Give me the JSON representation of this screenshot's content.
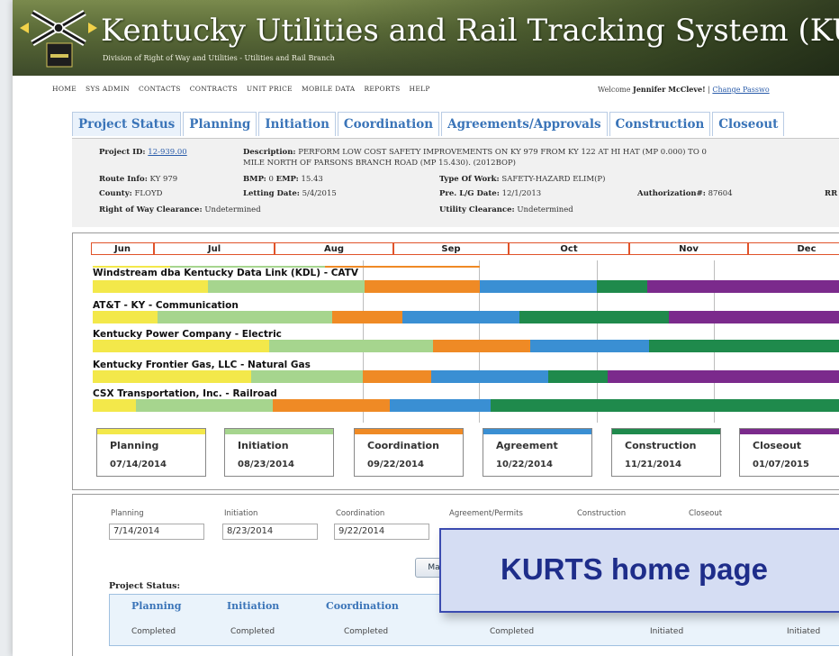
{
  "header": {
    "title": "Kentucky Utilities and Rail Tracking System (KURTS",
    "subtitle": "Division of Right of Way and Utilities - Utilities and Rail Branch"
  },
  "nav": {
    "items": [
      "Home",
      "Sys Admin",
      "Contacts",
      "Contracts",
      "Unit Price",
      "Mobile Data",
      "Reports",
      "Help"
    ]
  },
  "user": {
    "welcome_prefix": "Welcome",
    "name": "Jennifer McCleve!",
    "separator": "|",
    "change_password": "Change Passwo"
  },
  "tabs": [
    "Project Status",
    "Planning",
    "Initiation",
    "Coordination",
    "Agreements/Approvals",
    "Construction",
    "Closeout"
  ],
  "project": {
    "id_label": "Project ID:",
    "id_value": "12-939.00",
    "desc_label": "Description:",
    "desc_line1": "PERFORM LOW COST SAFETY IMPROVEMENTS ON KY 979 FROM KY 122 AT HI HAT (MP 0.000) TO 0",
    "desc_line2": "MILE NORTH OF PARSONS BRANCH ROAD (MP 15.430). (2012BOP)",
    "route_label": "Route Info:",
    "route_value": "KY 979",
    "bmp_label": "BMP:",
    "bmp_value": "0",
    "emp_label": "EMP:",
    "emp_value": "15.43",
    "work_label": "Type Of Work:",
    "work_value": "SAFETY-HAZARD ELIM(P)",
    "county_label": "County:",
    "county_value": "FLOYD",
    "letting_label": "Letting Date:",
    "letting_value": "5/4/2015",
    "prelg_label": "Pre. L/G Date:",
    "prelg_value": "12/1/2013",
    "auth_label": "Authorization#:",
    "auth_value": "87604",
    "rr_label": "RR",
    "row_label": "Right of Way Clearance:",
    "row_value": "Undetermined",
    "util_label": "Utility Clearance:",
    "util_value": "Undetermined"
  },
  "gantt": {
    "months": [
      "Jun",
      "Jul",
      "Aug",
      "Sep",
      "Oct",
      "Nov",
      "Dec"
    ],
    "colors": {
      "planning": "#f3e84a",
      "initiation": "#a6d58e",
      "coordination": "#ef8a25",
      "agreement": "#3a8fd3",
      "construction": "#1f8a4c",
      "closeout": "#7b2a8c"
    },
    "utilities": [
      {
        "name": "Windstream dba Kentucky Data Link (KDL) - CATV"
      },
      {
        "name": "AT&T - KY - Communication"
      },
      {
        "name": "Kentucky Power Company - Electric"
      },
      {
        "name": "Kentucky Frontier Gas, LLC - Natural Gas"
      },
      {
        "name": "CSX Transportation, Inc. - Railroad"
      }
    ],
    "phases": [
      {
        "label": "Planning",
        "date": "07/14/2014",
        "color": "#f3e84a"
      },
      {
        "label": "Initiation",
        "date": "08/23/2014",
        "color": "#a6d58e"
      },
      {
        "label": "Coordination",
        "date": "09/22/2014",
        "color": "#ef8a25"
      },
      {
        "label": "Agreement",
        "date": "10/22/2014",
        "color": "#3a8fd3"
      },
      {
        "label": "Construction",
        "date": "11/21/2014",
        "color": "#1f8a4c"
      },
      {
        "label": "Closeout",
        "date": "01/07/2015",
        "color": "#7b2a8c"
      }
    ]
  },
  "dates": {
    "labels": [
      "Planning",
      "Initiation",
      "Coordination",
      "Agreement/Permits",
      "Construction",
      "Closeout"
    ],
    "values": [
      "7/14/2014",
      "8/23/2014",
      "9/22/2014"
    ],
    "button_label": "Ma"
  },
  "status": {
    "title": "Project Status:",
    "headers": [
      "Planning",
      "Initiation",
      "Coordination"
    ],
    "values": [
      "Completed",
      "Completed",
      "Completed",
      "Completed",
      "Initiated",
      "Initiated"
    ]
  },
  "caption": "KURTS home page"
}
